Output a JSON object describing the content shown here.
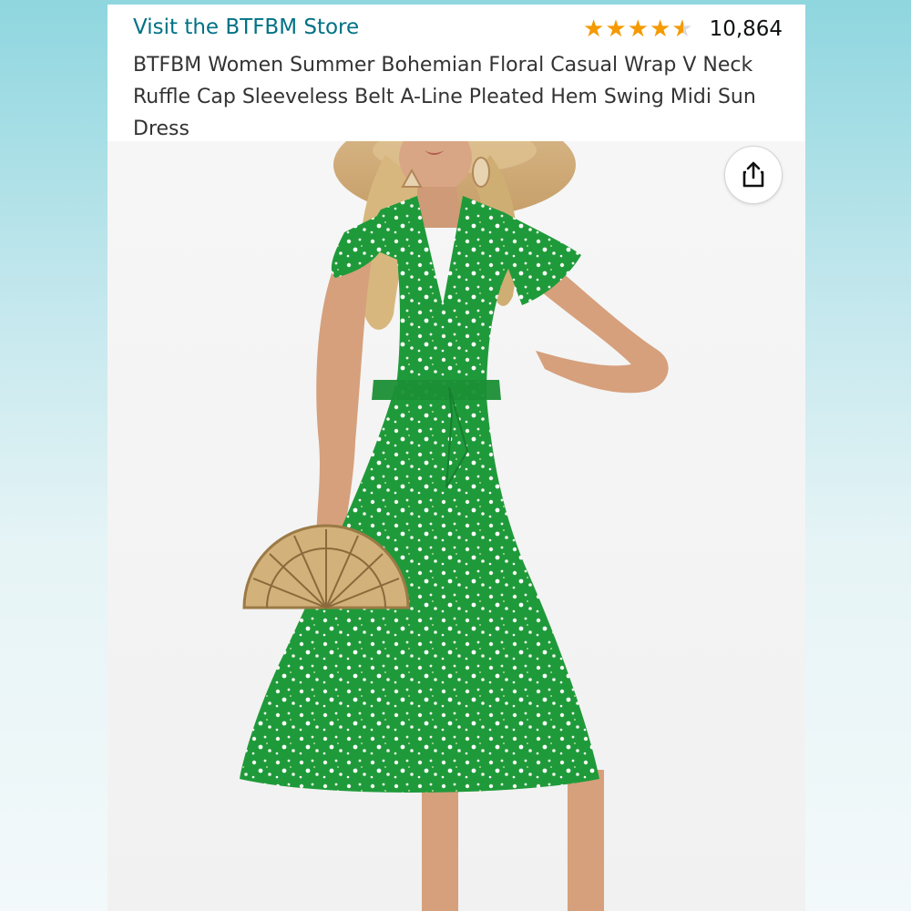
{
  "store": {
    "link_text": "Visit the BTFBM Store"
  },
  "rating": {
    "stars": 4.5,
    "count": "10,864",
    "star_color": "#f59a00"
  },
  "product": {
    "title": "BTFBM Women Summer Bohemian Floral Casual Wrap V Neck Ruffle Cap Sleeveless Belt A-Line Pleated Hem Swing Midi Sun Dress",
    "dress_color": "#1f9a3a",
    "link_color": "#007185"
  },
  "icons": {
    "share": "share-icon"
  }
}
